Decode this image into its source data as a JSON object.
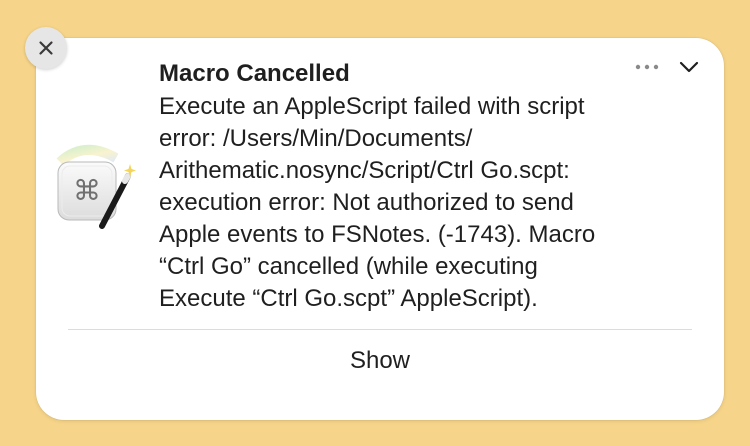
{
  "notification": {
    "title": "Macro Cancelled",
    "message_lines": [
      "Execute an AppleScript failed with script",
      "error: /Users/Min/Documents/",
      "Arithematic.nosync/Script/Ctrl Go.scpt:",
      "execution error: Not authorized to send",
      "Apple events to FSNotes. (-1743). Macro",
      "“Ctrl Go” cancelled (while executing",
      "Execute “Ctrl Go.scpt” AppleScript)."
    ],
    "action_label": "Show",
    "more_glyph": "•••"
  },
  "icons": {
    "close": "close-icon",
    "more": "ellipsis-icon",
    "collapse": "chevron-down-icon",
    "app": "keyboard-maestro-icon"
  },
  "app_icon": {
    "glyph": "⌘"
  },
  "colors": {
    "background": "#f6d489",
    "card": "#ffffff",
    "text": "#1f1f1f",
    "secondary": "#8a8a8a"
  }
}
